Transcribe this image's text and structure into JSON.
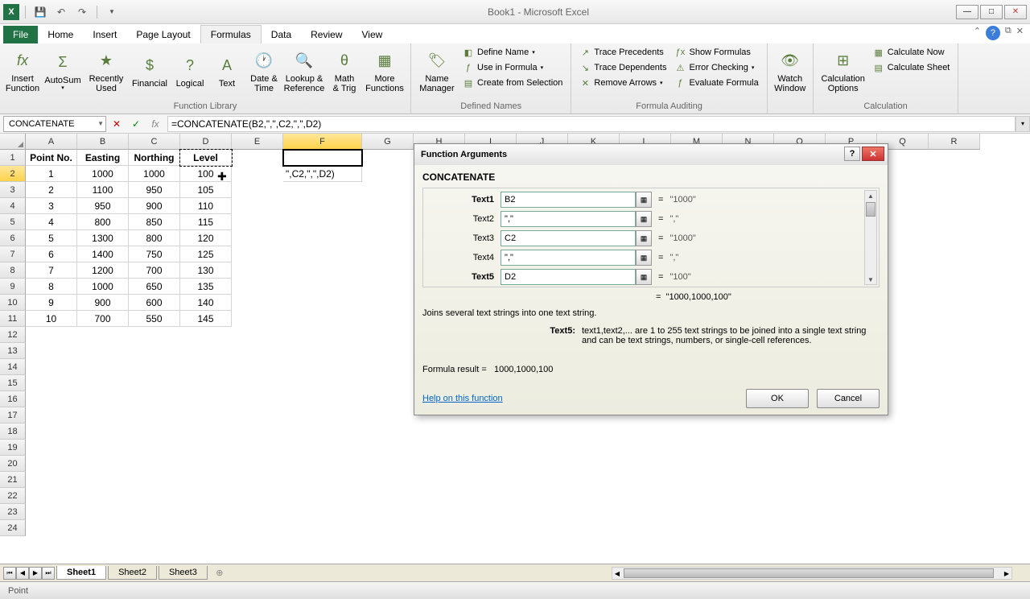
{
  "title": "Book1 - Microsoft Excel",
  "tabs": {
    "file": "File",
    "home": "Home",
    "insert": "Insert",
    "page_layout": "Page Layout",
    "formulas": "Formulas",
    "data": "Data",
    "review": "Review",
    "view": "View"
  },
  "ribbon": {
    "insert_function": "Insert\nFunction",
    "autosum": "AutoSum",
    "recently_used": "Recently\nUsed",
    "financial": "Financial",
    "logical": "Logical",
    "text": "Text",
    "date_time": "Date &\nTime",
    "lookup_ref": "Lookup &\nReference",
    "math_trig": "Math\n& Trig",
    "more_functions": "More\nFunctions",
    "group_fl": "Function Library",
    "name_manager": "Name\nManager",
    "define_name": "Define Name",
    "use_in_formula": "Use in Formula",
    "create_from_selection": "Create from Selection",
    "group_dn": "Defined Names",
    "trace_precedents": "Trace Precedents",
    "trace_dependents": "Trace Dependents",
    "remove_arrows": "Remove Arrows",
    "show_formulas": "Show Formulas",
    "error_checking": "Error Checking",
    "evaluate_formula": "Evaluate Formula",
    "group_fa": "Formula Auditing",
    "watch_window": "Watch\nWindow",
    "calc_options": "Calculation\nOptions",
    "calc_now": "Calculate Now",
    "calc_sheet": "Calculate Sheet",
    "group_calc": "Calculation"
  },
  "name_box": "CONCATENATE",
  "formula": "=CONCATENATE(B2,\",\",C2,\",\",D2)",
  "columns": [
    "A",
    "B",
    "C",
    "D",
    "E",
    "F",
    "G",
    "H",
    "I",
    "J",
    "K",
    "L",
    "M",
    "N",
    "O",
    "P",
    "Q",
    "R"
  ],
  "headers": {
    "A": "Point No.",
    "B": "Easting",
    "C": "Northing",
    "D": "Level"
  },
  "rows": [
    {
      "A": "1",
      "B": "1000",
      "C": "1000",
      "D": "100",
      "F": "\",C2,\",\",D2)"
    },
    {
      "A": "2",
      "B": "1100",
      "C": "950",
      "D": "105"
    },
    {
      "A": "3",
      "B": "950",
      "C": "900",
      "D": "110"
    },
    {
      "A": "4",
      "B": "800",
      "C": "850",
      "D": "115"
    },
    {
      "A": "5",
      "B": "1300",
      "C": "800",
      "D": "120"
    },
    {
      "A": "6",
      "B": "1400",
      "C": "750",
      "D": "125"
    },
    {
      "A": "7",
      "B": "1200",
      "C": "700",
      "D": "130"
    },
    {
      "A": "8",
      "B": "1000",
      "C": "650",
      "D": "135"
    },
    {
      "A": "9",
      "B": "900",
      "C": "600",
      "D": "140"
    },
    {
      "A": "10",
      "B": "700",
      "C": "550",
      "D": "145"
    }
  ],
  "dialog": {
    "title": "Function Arguments",
    "fn": "CONCATENATE",
    "args": [
      {
        "label": "Text1",
        "val": "B2",
        "result": "\"1000\"",
        "bold": true
      },
      {
        "label": "Text2",
        "val": "\",\"",
        "result": "\",\""
      },
      {
        "label": "Text3",
        "val": "C2",
        "result": "\"1000\""
      },
      {
        "label": "Text4",
        "val": "\",\"",
        "result": "\",\""
      },
      {
        "label": "Text5",
        "val": "D2",
        "result": "\"100\"",
        "bold": true
      }
    ],
    "overall": "\"1000,1000,100\"",
    "desc": "Joins several text strings into one text string.",
    "arg_help_label": "Text5:",
    "arg_help_text": "text1,text2,... are 1 to 255 text strings to be joined into a single text string and can be text strings, numbers, or single-cell references.",
    "formula_result_label": "Formula result =",
    "formula_result": "1000,1000,100",
    "help_link": "Help on this function",
    "ok": "OK",
    "cancel": "Cancel"
  },
  "sheets": {
    "s1": "Sheet1",
    "s2": "Sheet2",
    "s3": "Sheet3"
  },
  "status": "Point"
}
